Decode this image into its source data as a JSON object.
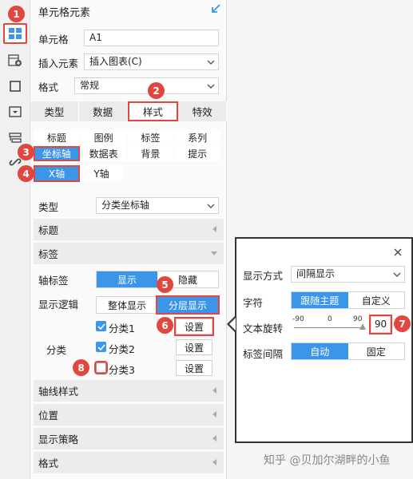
{
  "rail": {
    "items": [
      {
        "icon": "cell-grid-icon",
        "active": true
      },
      {
        "icon": "insert-element-icon",
        "active": false
      },
      {
        "icon": "border-icon",
        "active": false
      },
      {
        "icon": "widget-icon",
        "active": false
      },
      {
        "icon": "condition-icon",
        "active": false
      },
      {
        "icon": "hyperlink-icon",
        "active": false
      }
    ]
  },
  "panel": {
    "title": "单元格元素",
    "cell": {
      "label": "单元格",
      "value": "A1"
    },
    "insert": {
      "label": "插入元素",
      "value": "插入图表(C)"
    },
    "format": {
      "label": "格式",
      "value": "常规"
    },
    "tabs": [
      "类型",
      "数据",
      "样式",
      "特效"
    ],
    "style_items": [
      "标题",
      "图例",
      "标签",
      "系列",
      "坐标轴",
      "数据表",
      "背景",
      "提示"
    ],
    "axis_tabs": [
      "X轴",
      "Y轴"
    ],
    "type": {
      "label": "类型",
      "value": "分类坐标轴"
    },
    "sections": {
      "title": "标题",
      "label": "标签",
      "axis_line_style": "轴线样式",
      "position": "位置",
      "display_strategy": "显示策略",
      "format": "格式"
    },
    "axis_label": {
      "label": "轴标签",
      "show": "显示",
      "hide": "隐藏"
    },
    "display_logic": {
      "label": "显示逻辑",
      "whole": "整体显示",
      "layered": "分层显示"
    },
    "category_group_label": "分类",
    "categories": [
      {
        "name": "分类1",
        "checked": true,
        "button": "设置"
      },
      {
        "name": "分类2",
        "checked": true,
        "button": "设置"
      },
      {
        "name": "分类3",
        "checked": false,
        "button": "设置"
      }
    ]
  },
  "popup": {
    "display_mode": {
      "label": "显示方式",
      "value": "间隔显示"
    },
    "font": {
      "label": "字符",
      "follow": "跟随主题",
      "custom": "自定义"
    },
    "rotation": {
      "label": "文本旋转",
      "min": "-90",
      "mid": "0",
      "max": "90",
      "value": "90"
    },
    "spacing": {
      "label": "标签间隔",
      "auto": "自动",
      "fixed": "固定"
    }
  },
  "badges": [
    "1",
    "2",
    "3",
    "4",
    "5",
    "6",
    "7",
    "8"
  ],
  "watermark": "知乎 @贝加尔湖畔的小鱼",
  "colors": {
    "accent": "#3b95e8",
    "annotation": "#e0473e"
  }
}
